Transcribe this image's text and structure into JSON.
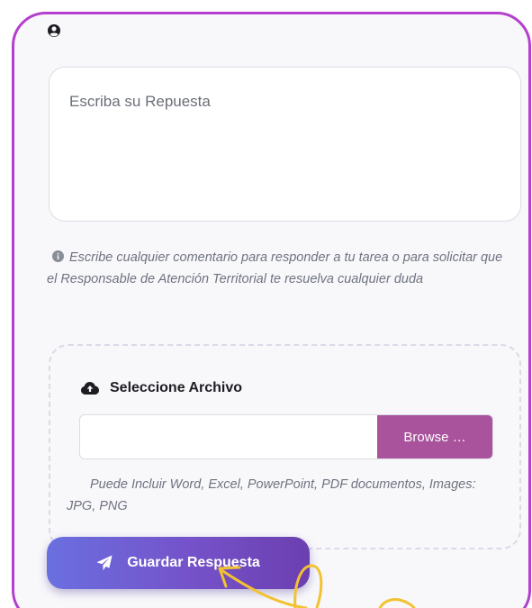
{
  "answer": {
    "placeholder": "Escriba su Repuesta"
  },
  "hint": {
    "text": "Escribe cualquier comentario para responder a tu tarea o para solicitar que el Responsable de Atención Territorial te resuelva cualquier duda"
  },
  "upload": {
    "title": "Seleccione Archivo",
    "file_value": "",
    "browse_label": "Browse …",
    "help_text": "Puede Incluir Word, Excel, PowerPoint, PDF documentos, Images: JPG, PNG"
  },
  "actions": {
    "save_label": "Guardar Respuesta"
  },
  "icons": {
    "user": "user-circle-icon",
    "info": "info-circle-icon",
    "upload": "cloud-upload-icon",
    "send": "paper-plane-icon"
  },
  "colors": {
    "frame_border": "#b43fce",
    "browse_button": "#a9539d",
    "save_button_start": "#6a6fe0",
    "save_button_end": "#6b3fb0",
    "annotation": "#f2c230"
  }
}
